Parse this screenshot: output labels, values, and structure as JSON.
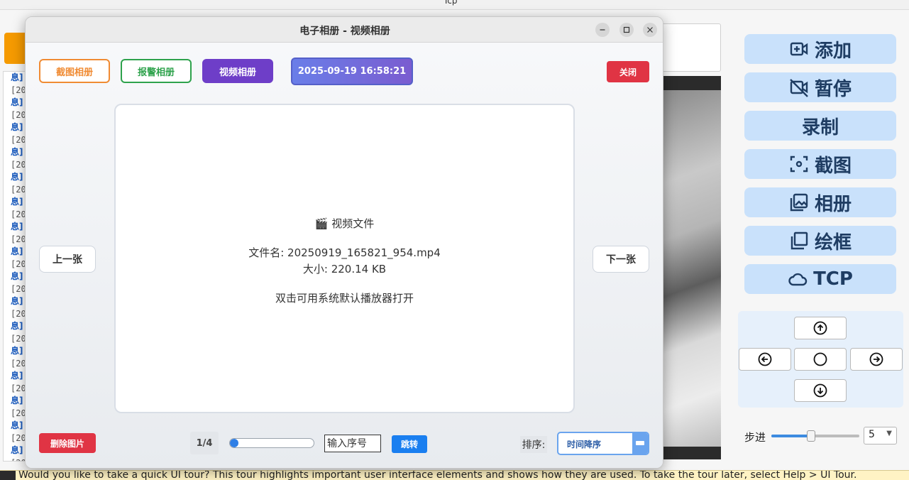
{
  "background_app": {
    "window_title": "Tcp",
    "log_lines": [
      "息]",
      "[20",
      "息]",
      "[20",
      "息]",
      "[20",
      "息]",
      "[20",
      "息]",
      "[20",
      "息]",
      "[20",
      "息]",
      "[20",
      "息]",
      "[20",
      "息]",
      "[20",
      "息]",
      "[20",
      "息]",
      "[20",
      "息]",
      "[20",
      "息]",
      "[20",
      "息]",
      "[20",
      "息]",
      "[20",
      "息]",
      "[20",
      "息]"
    ],
    "side_buttons": [
      {
        "label": "添加",
        "icon": "video-add-icon"
      },
      {
        "label": "暂停",
        "icon": "video-off-icon"
      },
      {
        "label": "录制",
        "icon": ""
      },
      {
        "label": "截图",
        "icon": "screenshot-icon"
      },
      {
        "label": "相册",
        "icon": "photo-album-icon"
      },
      {
        "label": "绘框",
        "icon": "draw-frame-icon"
      },
      {
        "label": "TCP",
        "icon": "cloud-icon"
      }
    ],
    "step": {
      "label": "步进",
      "value": "5",
      "slider_fraction": 0.45
    },
    "tour_message": "Would you like to take a quick UI tour? This tour highlights important user interface elements and shows how they are used. To take the tour later, select Help > UI Tour."
  },
  "dialog": {
    "title": "电子相册 - 视频相册",
    "tabs": {
      "screenshot": "截图相册",
      "alarm": "报警相册",
      "video": "视频相册"
    },
    "datetime": "2025-09-19 16:58:21",
    "close_label": "关闭",
    "viewer": {
      "heading": "🎬 视频文件",
      "filename": "文件名: 20250919_165821_954.mp4",
      "size": "大小: 220.14 KB",
      "hint": "双击可用系统默认播放器打开"
    },
    "prev_label": "上一张",
    "next_label": "下一张",
    "delete_label": "删除图片",
    "page_indicator": "1/4",
    "progress_fraction": 0.1,
    "jump_placeholder": "输入序号",
    "jump_label": "跳转",
    "sort_label": "排序:",
    "sort_value": "时间降序"
  },
  "colors": {
    "accent_blue": "#1a7ff0",
    "danger_red": "#e03444",
    "video_tab_purple": "#6e3ec8",
    "side_button_bg": "#c9e1fb"
  }
}
